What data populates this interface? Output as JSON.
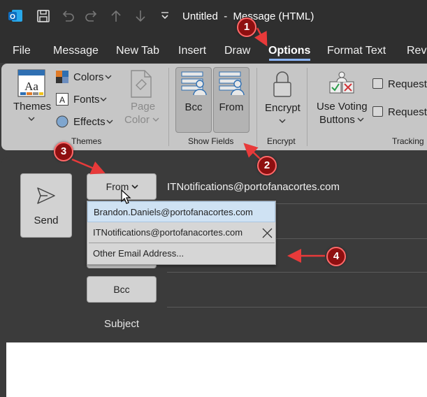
{
  "window": {
    "title": "Untitled  -  Message (HTML)"
  },
  "icons": {
    "app": "outlook-icon",
    "save": "save-icon",
    "undo": "undo-icon",
    "redo": "redo-icon",
    "up": "arrow-up-icon",
    "down": "arrow-down-icon",
    "customize": "customize-quick-access-icon"
  },
  "tabs": [
    {
      "label": "File"
    },
    {
      "label": "Message"
    },
    {
      "label": "New Tab"
    },
    {
      "label": "Insert"
    },
    {
      "label": "Draw"
    },
    {
      "label": "Options",
      "active": true
    },
    {
      "label": "Format Text"
    },
    {
      "label": "Revi"
    }
  ],
  "ribbon": {
    "themes": {
      "themes_label": "Themes",
      "colors_label": "Colors",
      "fonts_label": "Fonts",
      "effects_label": "Effects",
      "page_color_line1": "Page",
      "page_color_line2": "Color",
      "group_label": "Themes"
    },
    "show_fields": {
      "bcc_label": "Bcc",
      "from_label": "From",
      "group_label": "Show Fields"
    },
    "encrypt": {
      "encrypt_label": "Encrypt",
      "group_label": "Encrypt"
    },
    "tracking": {
      "voting_line1": "Use Voting",
      "voting_line2": "Buttons",
      "request1": "Request",
      "request2": "Request",
      "group_label": "Tracking"
    }
  },
  "compose": {
    "send_label": "Send",
    "from_button": "From",
    "from_value": "ITNotifications@portofanacortes.com",
    "bcc_button": "Bcc",
    "subject_label": "Subject"
  },
  "dropdown": {
    "items": [
      {
        "label": "Brandon.Daniels@portofanacortes.com",
        "highlighted": true
      },
      {
        "label": "ITNotifications@portofanacortes.com"
      },
      {
        "label": "Other Email Address..."
      }
    ]
  },
  "callouts": [
    "1",
    "2",
    "3",
    "4"
  ],
  "colors": {
    "accent": "#8ab4f8",
    "callout": "#8e0f10",
    "callout_arrow": "#e83a3a"
  }
}
